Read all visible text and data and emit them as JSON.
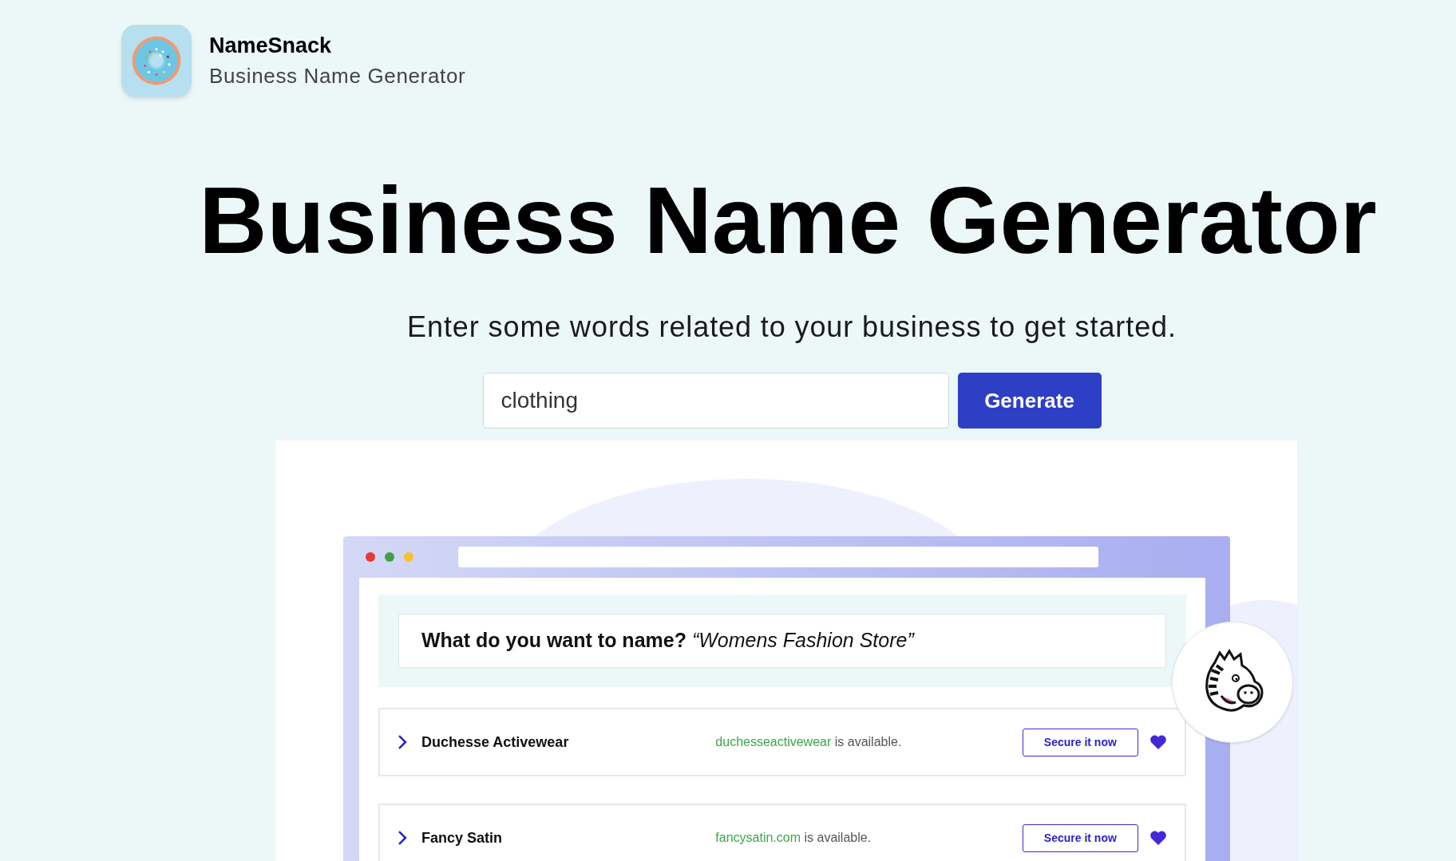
{
  "brand": {
    "name": "NameSnack",
    "tagline": "Business Name Generator"
  },
  "hero": {
    "title": "Business Name Generator",
    "subtitle": "Enter some words related to your business to get started."
  },
  "search": {
    "value": "clothing",
    "button": "Generate"
  },
  "preview": {
    "question": "What do you want to name?",
    "example": "“Womens Fashion Store”",
    "results": [
      {
        "name": "Duchesse Activewear",
        "domain": "duchesseactivewear",
        "status": "is available.",
        "action": "Secure it now"
      },
      {
        "name": "Fancy Satin",
        "domain": "fancysatin.com",
        "status": "is available.",
        "action": "Secure it now"
      }
    ]
  }
}
